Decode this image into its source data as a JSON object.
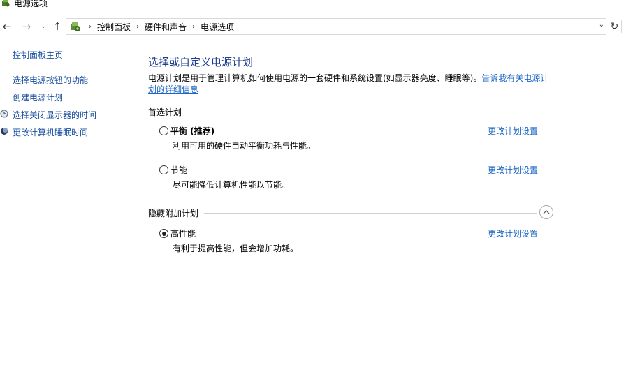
{
  "window": {
    "title": "电源选项"
  },
  "nav": {
    "back": "←",
    "forward": "→",
    "recent": "⌄",
    "up": "↑",
    "refresh": "↻",
    "address_dropdown": "⌄"
  },
  "breadcrumb": [
    "控制面板",
    "硬件和声音",
    "电源选项"
  ],
  "sidebar": {
    "home": "控制面板主页",
    "items": [
      "选择电源按钮的功能",
      "创建电源计划",
      "选择关闭显示器的时间",
      "更改计算机睡眠时间"
    ]
  },
  "main": {
    "title": "选择或自定义电源计划",
    "description": "电源计划是用于管理计算机如何使用电源的一套硬件和系统设置(如显示器亮度、睡眠等)。",
    "learn_more_link": "告诉我有关电源计划的详细信息",
    "preferred_section": "首选计划",
    "hidden_section": "隐藏附加计划",
    "plans": [
      {
        "name": "平衡 (推荐)",
        "desc": "利用可用的硬件自动平衡功耗与性能。",
        "link": "更改计划设置",
        "selected": false
      },
      {
        "name": "节能",
        "desc": "尽可能降低计算机性能以节能。",
        "link": "更改计划设置",
        "selected": false
      },
      {
        "name": "高性能",
        "desc": "有利于提高性能，但会增加功耗。",
        "link": "更改计划设置",
        "selected": true
      }
    ]
  },
  "icons": {
    "window": "power-options-icon",
    "address": "control-panel-icon",
    "display_timer": "monitor-clock-icon",
    "sleep": "moon-icon",
    "collapse": "chevron-up-icon"
  },
  "colors": {
    "link": "#1a66c4",
    "title": "#1e3f8f",
    "sidebar_link": "#1a4fa0"
  }
}
